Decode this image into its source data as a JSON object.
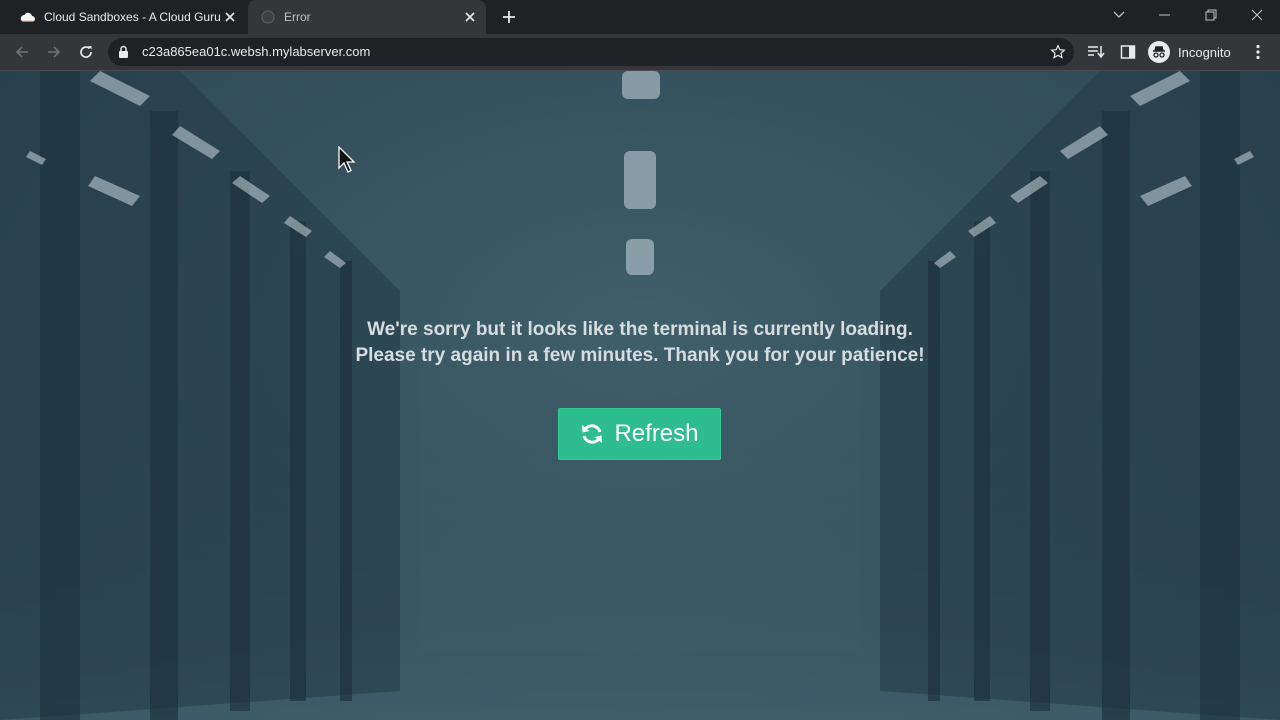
{
  "tabs": [
    {
      "title": "Cloud Sandboxes - A Cloud Guru",
      "active": false,
      "icon": "cloud-icon"
    },
    {
      "title": "Error",
      "active": true,
      "icon": "globe-icon"
    }
  ],
  "address_bar": {
    "url": "c23a865ea01c.websh.mylabserver.com"
  },
  "profile": {
    "label": "Incognito"
  },
  "page": {
    "message_line1": "We're sorry but it looks like the terminal is currently loading.",
    "message_line2": "Please try again in a few minutes. Thank you for your patience!",
    "refresh_label": "Refresh"
  },
  "colors": {
    "button": "#2dbd8e",
    "background": "#36525e",
    "chrome_dark": "#202124",
    "chrome_toolbar": "#35363a"
  }
}
